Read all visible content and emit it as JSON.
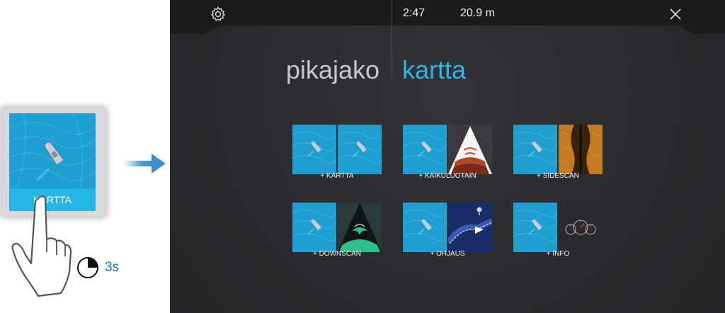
{
  "tile": {
    "label": "KARTTA"
  },
  "timer": {
    "label": "3s"
  },
  "statusbar": {
    "time": "2:47",
    "depth": "20.9 m"
  },
  "header": {
    "left_title": "pikajako",
    "right_title": "kartta"
  },
  "presets": [
    {
      "label": "+ KARTTA",
      "second": "chart"
    },
    {
      "label": "+ KAIKULUOTAIN",
      "second": "echo"
    },
    {
      "label": "+ SIDESCAN",
      "second": "sidescan"
    },
    {
      "label": "+ DOWNSCAN",
      "second": "downscan"
    },
    {
      "label": "+ OHJAUS",
      "second": "steer"
    },
    {
      "label": "+ INFO",
      "second": "info"
    }
  ],
  "colors": {
    "accent": "#2fb6e6",
    "chart_blue": "#1f9ed1",
    "background": "#2c2c30"
  },
  "icons": [
    "gear-icon",
    "close-icon",
    "arrow-right-icon",
    "hand-press-icon",
    "timer-icon",
    "boat-icon"
  ]
}
